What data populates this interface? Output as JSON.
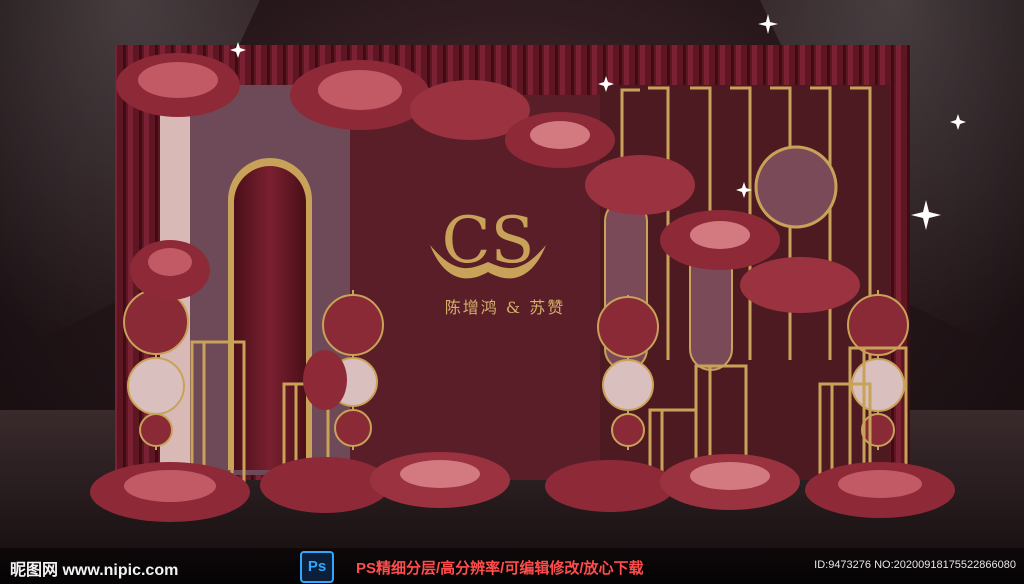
{
  "backdrop": {
    "monogram": "CS",
    "couple_names": "陈增鸿 & 苏赞",
    "colors": {
      "wall": "#5a1e28",
      "curtain": "#6a1a24",
      "gold": "#c9a25a",
      "mauve": "#6e4a58",
      "blush": "#d9bfbe"
    }
  },
  "watermark": {
    "site_label": "昵图网 www.nipic.com",
    "ps_badge": "Ps",
    "slogan": "PS精细分层/高分辨率/可编辑修改/放心下载",
    "id_text": "ID:9473276 NO:20200918175522866080"
  }
}
